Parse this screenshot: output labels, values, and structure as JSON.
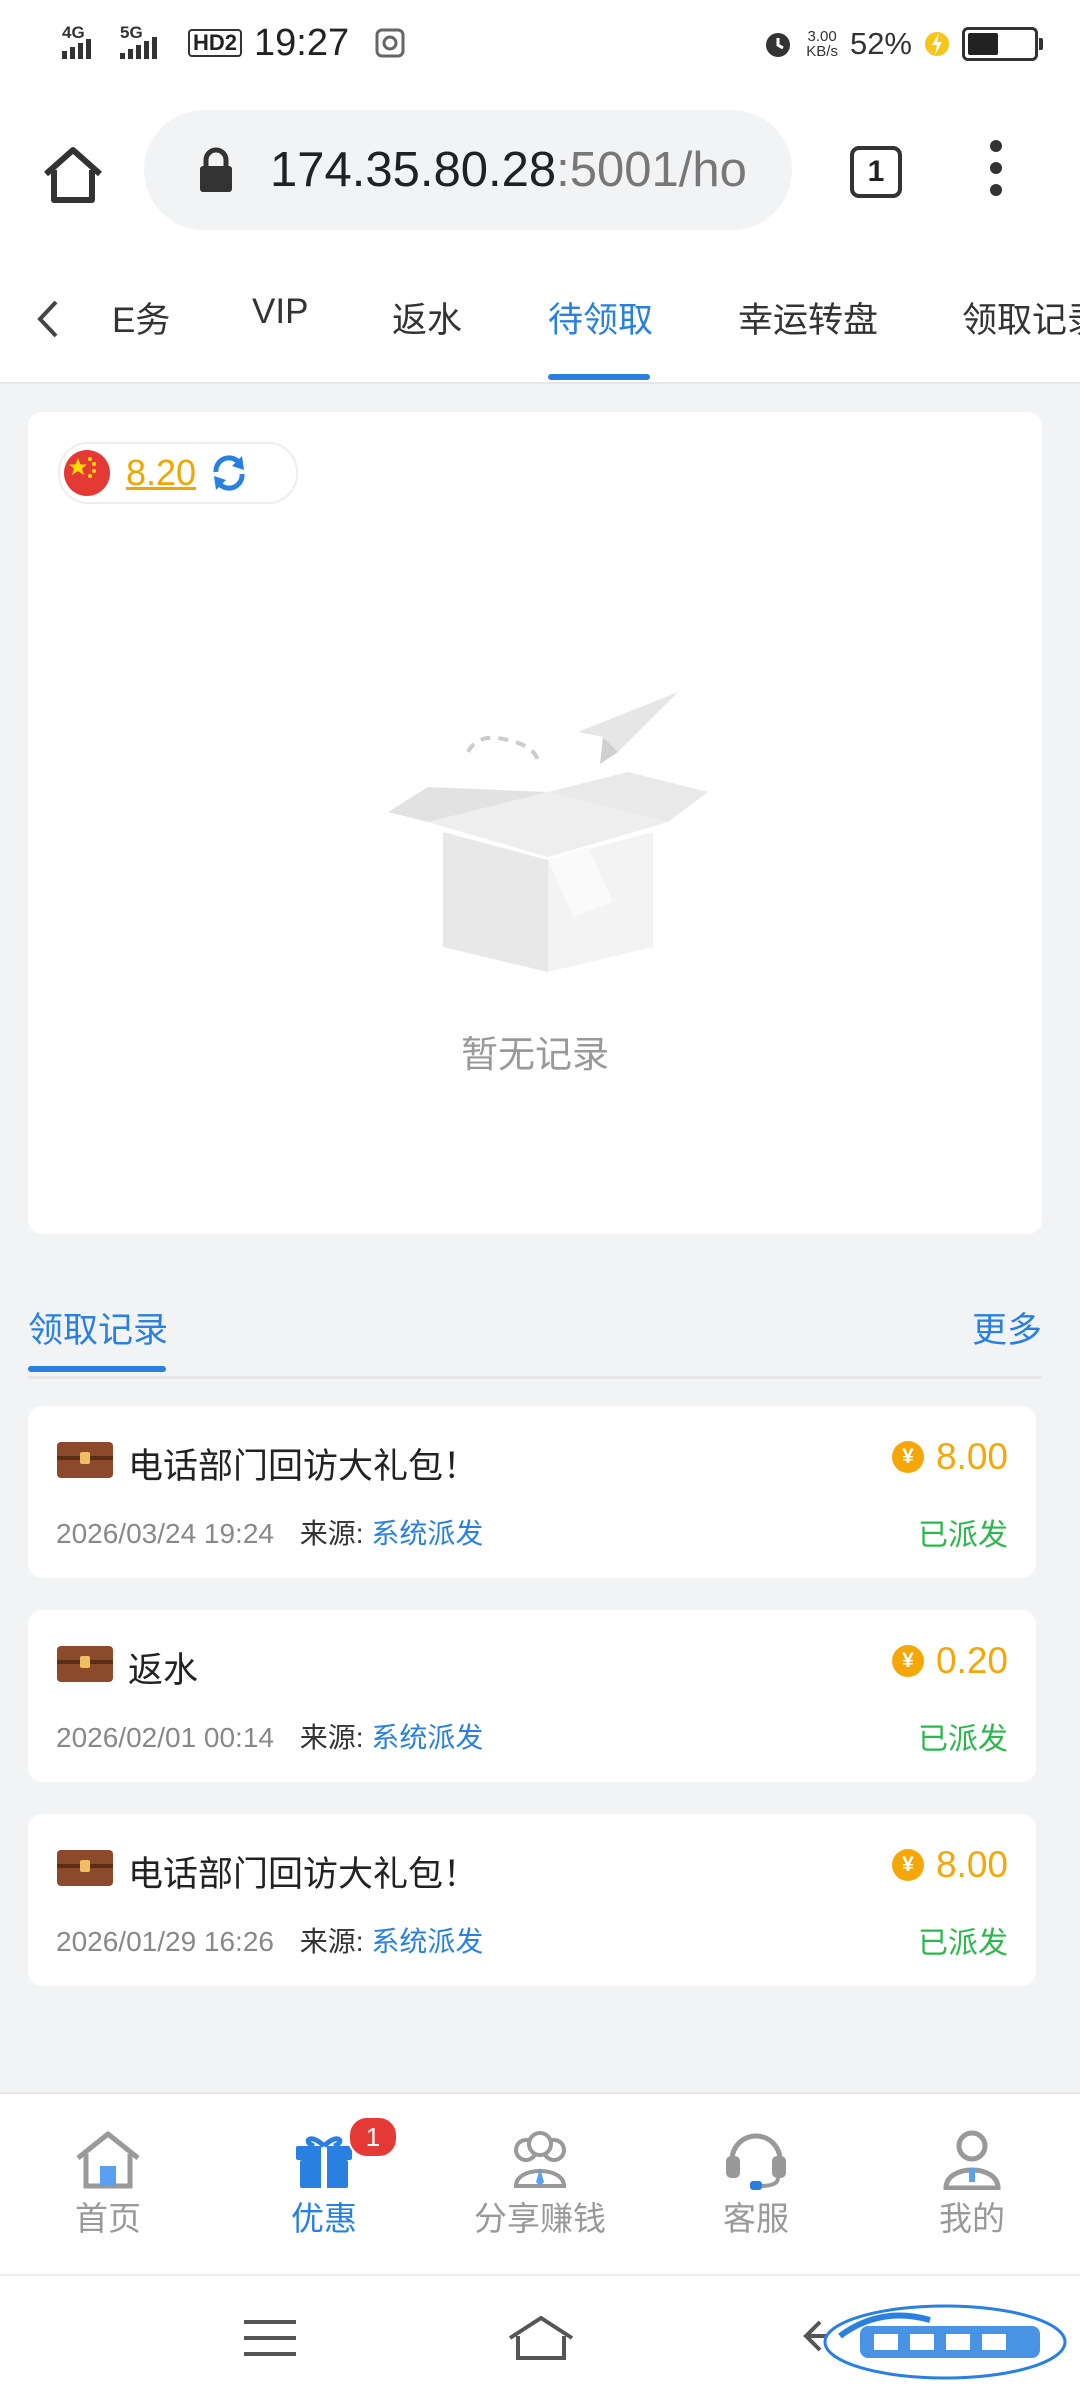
{
  "status_bar": {
    "network1": "4G",
    "network2": "5G",
    "hd": "HD2",
    "time": "19:27",
    "speed_value": "3.00",
    "speed_unit": "KB/s",
    "battery_percent": "52%",
    "battery_level": 0.52
  },
  "browser": {
    "url_host": "174.35.80.28",
    "url_rest": ":5001/ho",
    "tab_count": "1"
  },
  "category_tabs": {
    "items": [
      "E务",
      "VIP",
      "返水",
      "待领取",
      "幸运转盘",
      "领取记录"
    ],
    "active": "待领取"
  },
  "wallet": {
    "balance": "8.20"
  },
  "empty_state": {
    "text": "暂无记录"
  },
  "records": {
    "title": "领取记录",
    "more": "更多",
    "source_label": "来源:",
    "items": [
      {
        "name": "电话部门回访大礼包！",
        "amount": "8.00",
        "datetime": "2026/03/24 19:24",
        "source": "系统派发",
        "status": "已派发"
      },
      {
        "name": "返水",
        "amount": "0.20",
        "datetime": "2026/02/01 00:14",
        "source": "系统派发",
        "status": "已派发"
      },
      {
        "name": "电话部门回访大礼包！",
        "amount": "8.00",
        "datetime": "2026/01/29 16:26",
        "source": "系统派发",
        "status": "已派发"
      }
    ],
    "coin_symbol": "¥"
  },
  "bottom_nav": {
    "items": [
      "首页",
      "优惠",
      "分享赚钱",
      "客服",
      "我的"
    ],
    "active": "优惠",
    "badge": "1"
  },
  "colors": {
    "accent": "#2980e0",
    "amount": "#f5a70a",
    "status_ok": "#2db84d",
    "badge": "#e53935"
  }
}
